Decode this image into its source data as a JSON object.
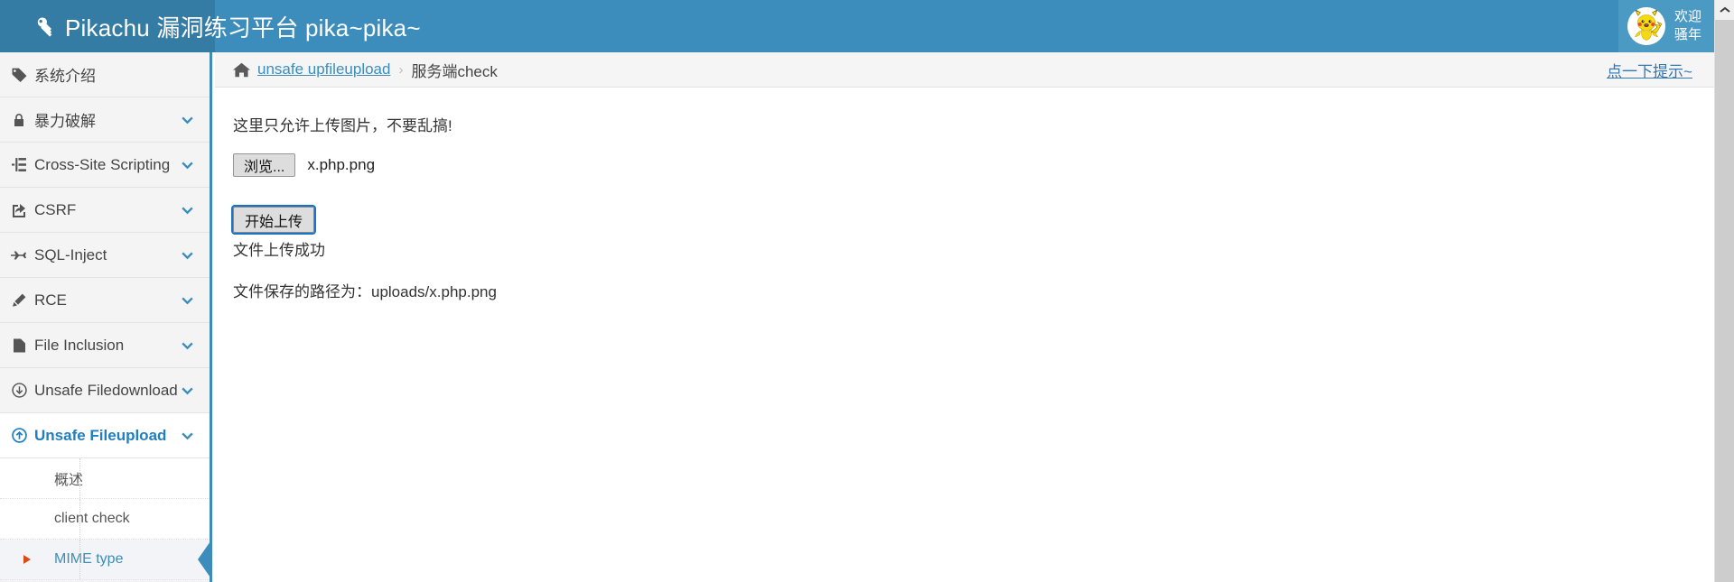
{
  "header": {
    "brand_title": "Pikachu 漏洞练习平台 pika~pika~",
    "brand_icon": "key-icon",
    "user": {
      "avatar_icon": "pikachu-avatar",
      "greeting_line1": "欢迎",
      "greeting_line2": "骚年"
    },
    "brand_bg": "#357ca5",
    "header_bg": "#3c8dbc"
  },
  "sidebar": {
    "items": [
      {
        "label": "系统介绍",
        "icon": "tag-icon",
        "has_arrow": false,
        "active": false
      },
      {
        "label": "暴力破解",
        "icon": "lock-icon",
        "has_arrow": true,
        "active": false
      },
      {
        "label": "Cross-Site Scripting",
        "icon": "sitemap-icon",
        "has_arrow": true,
        "active": false
      },
      {
        "label": "CSRF",
        "icon": "share-square-icon",
        "has_arrow": true,
        "active": false
      },
      {
        "label": "SQL-Inject",
        "icon": "plane-icon",
        "has_arrow": true,
        "active": false
      },
      {
        "label": "RCE",
        "icon": "pencil-icon",
        "has_arrow": true,
        "active": false
      },
      {
        "label": "File Inclusion",
        "icon": "file-icon",
        "has_arrow": true,
        "active": false
      },
      {
        "label": "Unsafe Filedownload",
        "icon": "arrow-circle-down-icon",
        "has_arrow": true,
        "active": false
      },
      {
        "label": "Unsafe Fileupload",
        "icon": "arrow-circle-up-icon",
        "has_arrow": true,
        "active": true
      }
    ],
    "submenu": [
      {
        "label": "概述",
        "active": false
      },
      {
        "label": "client check",
        "active": false
      },
      {
        "label": "MIME type",
        "active": true
      }
    ],
    "active_color": "#1f7fc0",
    "border_color": "#3c8dbc"
  },
  "breadcrumb": {
    "home_icon": "home-icon",
    "link_label": "unsafe upfileupload",
    "separator": "›",
    "current_label": "服务端check",
    "hint_label": "点一下提示~",
    "link_color": "#3c8dbc"
  },
  "main": {
    "notice": "这里只允许上传图片，不要乱搞!",
    "browse_button_label": "浏览...",
    "selected_file": "x.php.png",
    "upload_button_label": "开始上传",
    "upload_result": "文件上传成功",
    "saved_path_line": "文件保存的路径为：uploads/x.php.png"
  },
  "scrollbar": {
    "up_arrow": "chevron-up-icon"
  }
}
